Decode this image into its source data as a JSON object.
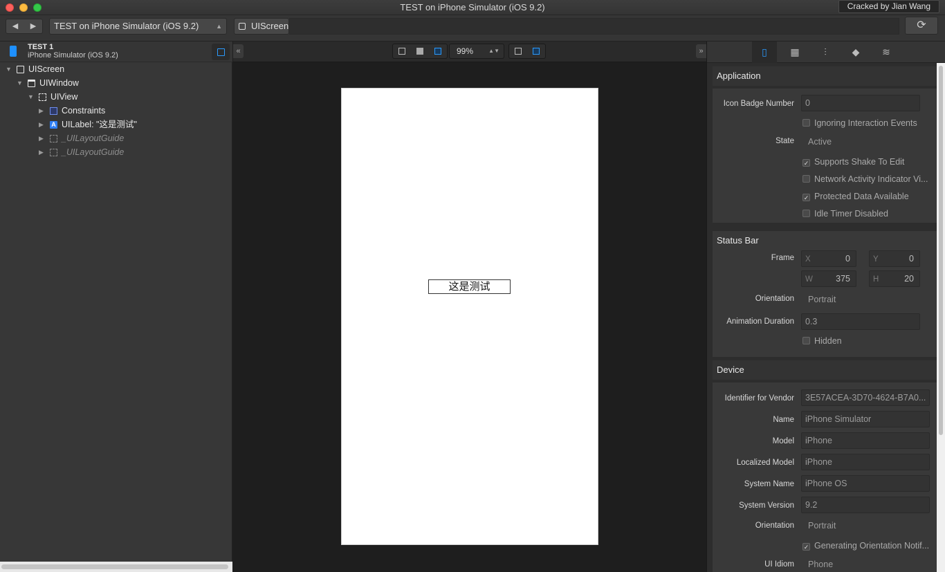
{
  "window": {
    "title": "TEST on iPhone Simulator (iOS 9.2)",
    "badge": "Cracked by Jian Wang"
  },
  "toolbar": {
    "back": "◀",
    "forward": "▶",
    "scheme": "TEST on iPhone Simulator (iOS 9.2)",
    "breadcrumb": "UIScreen",
    "refresh": "⟳"
  },
  "left": {
    "app_name": "TEST 1",
    "device": "iPhone Simulator (iOS 9.2)",
    "tree": [
      {
        "label": "UIScreen"
      },
      {
        "label": "UIWindow"
      },
      {
        "label": "UIView"
      },
      {
        "label": "Constraints"
      },
      {
        "label": "UILabel: \"这是测试\""
      },
      {
        "label": "_UILayoutGuide"
      },
      {
        "label": "_UILayoutGuide"
      }
    ]
  },
  "canvas": {
    "zoom": "99%",
    "label_text": "这是测试",
    "collapse_left": "«",
    "collapse_right": "»"
  },
  "inspector": {
    "application": {
      "title": "Application",
      "icon_badge_label": "Icon Badge Number",
      "icon_badge_value": "0",
      "ignoring": "Ignoring Interaction Events",
      "state_label": "State",
      "state_value": "Active",
      "supports_shake": "Supports Shake To Edit",
      "network_activity": "Network Activity Indicator Vi...",
      "protected_data": "Protected Data Available",
      "idle_timer": "Idle Timer Disabled"
    },
    "status_bar": {
      "title": "Status Bar",
      "frame_label": "Frame",
      "x_label": "X",
      "x": "0",
      "y_label": "Y",
      "y": "0",
      "w_label": "W",
      "w": "375",
      "h_label": "H",
      "h": "20",
      "orientation_label": "Orientation",
      "orientation": "Portrait",
      "anim_label": "Animation Duration",
      "anim": "0.3",
      "hidden": "Hidden"
    },
    "device": {
      "title": "Device",
      "vendor_label": "Identifier for Vendor",
      "vendor": "3E57ACEA-3D70-4624-B7A0...",
      "name_label": "Name",
      "name": "iPhone Simulator",
      "model_label": "Model",
      "model": "iPhone",
      "loc_model_label": "Localized Model",
      "loc_model": "iPhone",
      "sys_name_label": "System Name",
      "sys_name": "iPhone OS",
      "sys_ver_label": "System Version",
      "sys_ver": "9.2",
      "orientation_label": "Orientation",
      "orientation": "Portrait",
      "gen_orient": "Generating Orientation Notif...",
      "idiom_label": "UI Idiom",
      "idiom": "Phone"
    }
  },
  "colors": {
    "accent": "#2b9bff",
    "bg": "#1e1e1e",
    "panel": "#373737"
  }
}
